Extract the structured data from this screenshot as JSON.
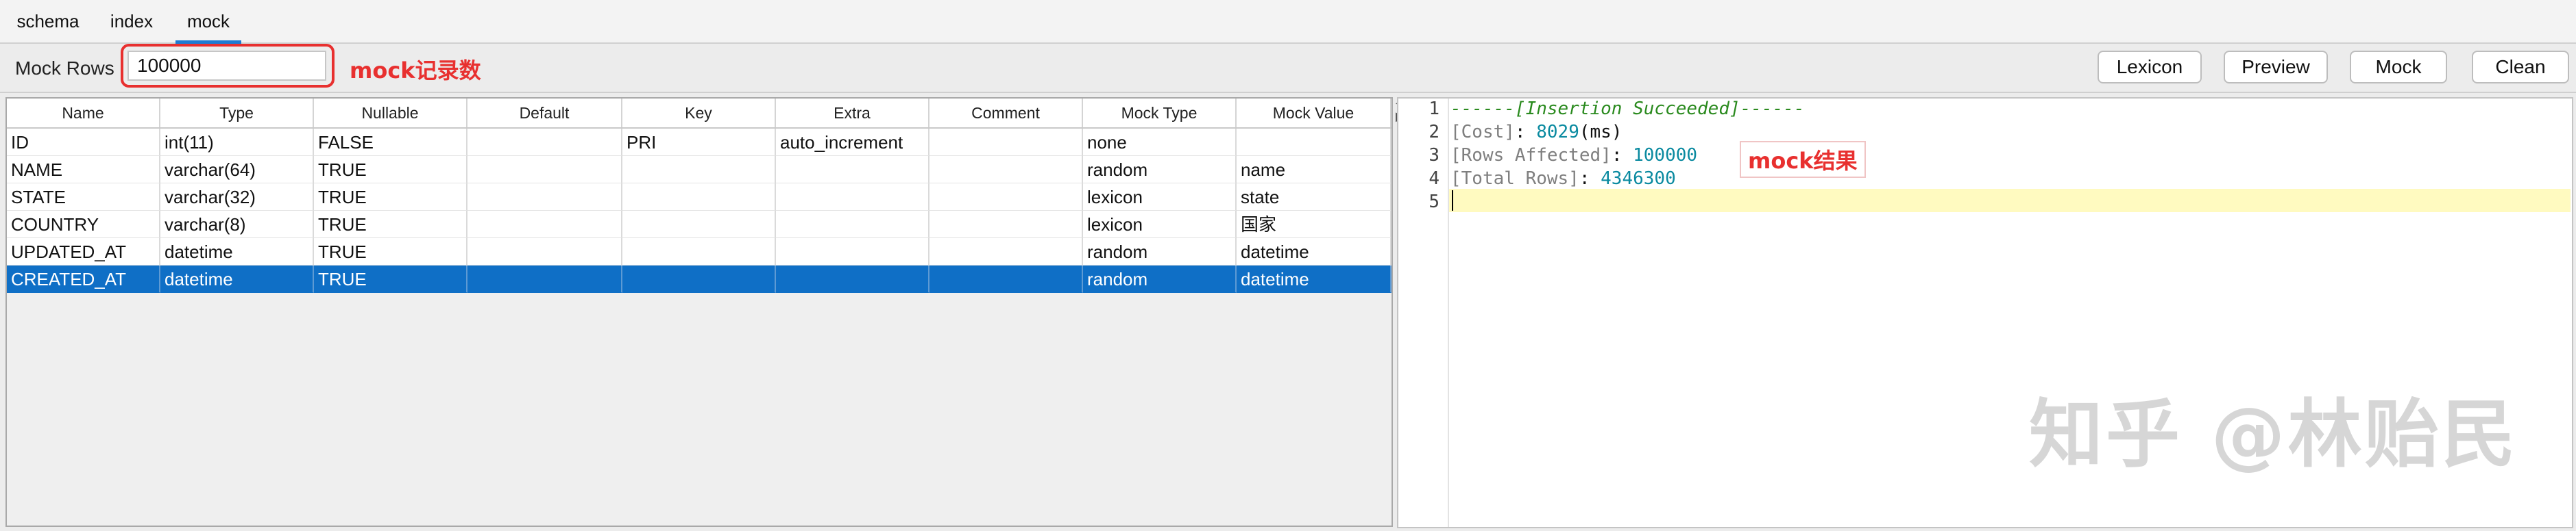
{
  "tabs": [
    {
      "label": "schema"
    },
    {
      "label": "index"
    },
    {
      "label": "mock",
      "active": true
    }
  ],
  "toolbar": {
    "rows_label": "Mock Rows",
    "rows_value": "100000",
    "rows_annotation": "mock记录数",
    "buttons": {
      "lexicon": "Lexicon",
      "preview": "Preview",
      "mock": "Mock",
      "clean": "Clean"
    }
  },
  "grid": {
    "columns": [
      "Name",
      "Type",
      "Nullable",
      "Default",
      "Key",
      "Extra",
      "Comment",
      "Mock Type",
      "Mock Value"
    ],
    "rows": [
      [
        "ID",
        "int(11)",
        "FALSE",
        "",
        "PRI",
        "auto_increment",
        "",
        "none",
        ""
      ],
      [
        "NAME",
        "varchar(64)",
        "TRUE",
        "",
        "",
        "",
        "",
        "random",
        "name"
      ],
      [
        "STATE",
        "varchar(32)",
        "TRUE",
        "",
        "",
        "",
        "",
        "lexicon",
        "state"
      ],
      [
        "COUNTRY",
        "varchar(8)",
        "TRUE",
        "",
        "",
        "",
        "",
        "lexicon",
        "国家"
      ],
      [
        "UPDATED_AT",
        "datetime",
        "TRUE",
        "",
        "",
        "",
        "",
        "random",
        "datetime"
      ],
      [
        "CREATED_AT",
        "datetime",
        "TRUE",
        "",
        "",
        "",
        "",
        "random",
        "datetime"
      ]
    ],
    "selected_row_index": 5
  },
  "output": {
    "line_numbers": [
      "1",
      "2",
      "3",
      "4",
      "5"
    ],
    "line1": "------[Insertion Succeeded]------",
    "cost_key": "[Cost]",
    "cost_sep": ": ",
    "cost_value": "8029",
    "cost_unit_open": "(",
    "cost_unit": "ms",
    "cost_unit_close": ")",
    "affected_key": "[Rows Affected]",
    "affected_sep": ": ",
    "affected_value": "100000",
    "total_key": "[Total Rows]",
    "total_sep": ": ",
    "total_value": "4346300",
    "result_annotation": "mock结果"
  },
  "watermark": "知乎 @林贻民",
  "colors": {
    "accent": "#0f6fc6",
    "annotation_red": "#e8302f",
    "success_green": "#2a8a1e",
    "bracket_gray": "#7f7f7f",
    "value_teal": "#0a8aa0",
    "current_line": "#fffac0"
  }
}
